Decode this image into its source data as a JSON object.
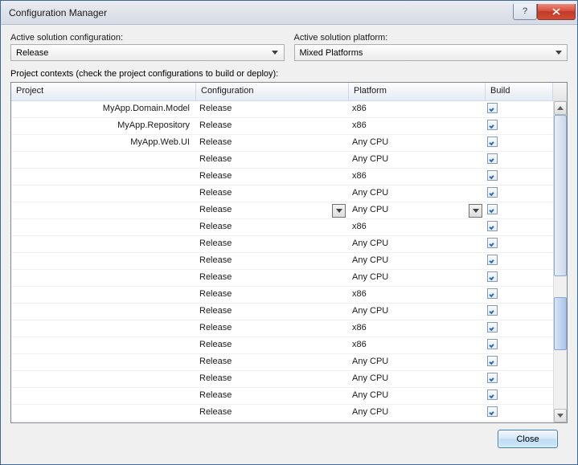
{
  "window": {
    "title": "Configuration Manager"
  },
  "combos": {
    "solution_config": {
      "label": "Active solution configuration:",
      "value": "Release"
    },
    "solution_platform": {
      "label": "Active solution platform:",
      "value": "Mixed Platforms"
    }
  },
  "section_label": "Project contexts (check the project configurations to build or deploy):",
  "headers": {
    "project": "Project",
    "config": "Configuration",
    "platform": "Platform",
    "build": "Build"
  },
  "rows": [
    {
      "project": "MyApp.Domain.Model",
      "config": "Release",
      "platform": "x86",
      "build": true,
      "active": false
    },
    {
      "project": "MyApp.Repository",
      "config": "Release",
      "platform": "x86",
      "build": true,
      "active": false
    },
    {
      "project": "MyApp.Web.UI",
      "config": "Release",
      "platform": "Any CPU",
      "build": true,
      "active": false
    },
    {
      "project": "",
      "config": "Release",
      "platform": "Any CPU",
      "build": true,
      "active": false
    },
    {
      "project": "",
      "config": "Release",
      "platform": "x86",
      "build": true,
      "active": false
    },
    {
      "project": "",
      "config": "Release",
      "platform": "Any CPU",
      "build": true,
      "active": false
    },
    {
      "project": "",
      "config": "Release",
      "platform": "Any CPU",
      "build": true,
      "active": true
    },
    {
      "project": "",
      "config": "Release",
      "platform": "x86",
      "build": true,
      "active": false
    },
    {
      "project": "",
      "config": "Release",
      "platform": "Any CPU",
      "build": true,
      "active": false
    },
    {
      "project": "",
      "config": "Release",
      "platform": "Any CPU",
      "build": true,
      "active": false
    },
    {
      "project": "",
      "config": "Release",
      "platform": "Any CPU",
      "build": true,
      "active": false
    },
    {
      "project": "",
      "config": "Release",
      "platform": "x86",
      "build": true,
      "active": false
    },
    {
      "project": "",
      "config": "Release",
      "platform": "Any CPU",
      "build": true,
      "active": false
    },
    {
      "project": "",
      "config": "Release",
      "platform": "x86",
      "build": true,
      "active": false
    },
    {
      "project": "",
      "config": "Release",
      "platform": "x86",
      "build": true,
      "active": false
    },
    {
      "project": "",
      "config": "Release",
      "platform": "Any CPU",
      "build": true,
      "active": false
    },
    {
      "project": "",
      "config": "Release",
      "platform": "Any CPU",
      "build": true,
      "active": false
    },
    {
      "project": "",
      "config": "Release",
      "platform": "Any CPU",
      "build": true,
      "active": false
    },
    {
      "project": "",
      "config": "Release",
      "platform": "Any CPU",
      "build": true,
      "active": false
    }
  ],
  "footer": {
    "close": "Close"
  }
}
